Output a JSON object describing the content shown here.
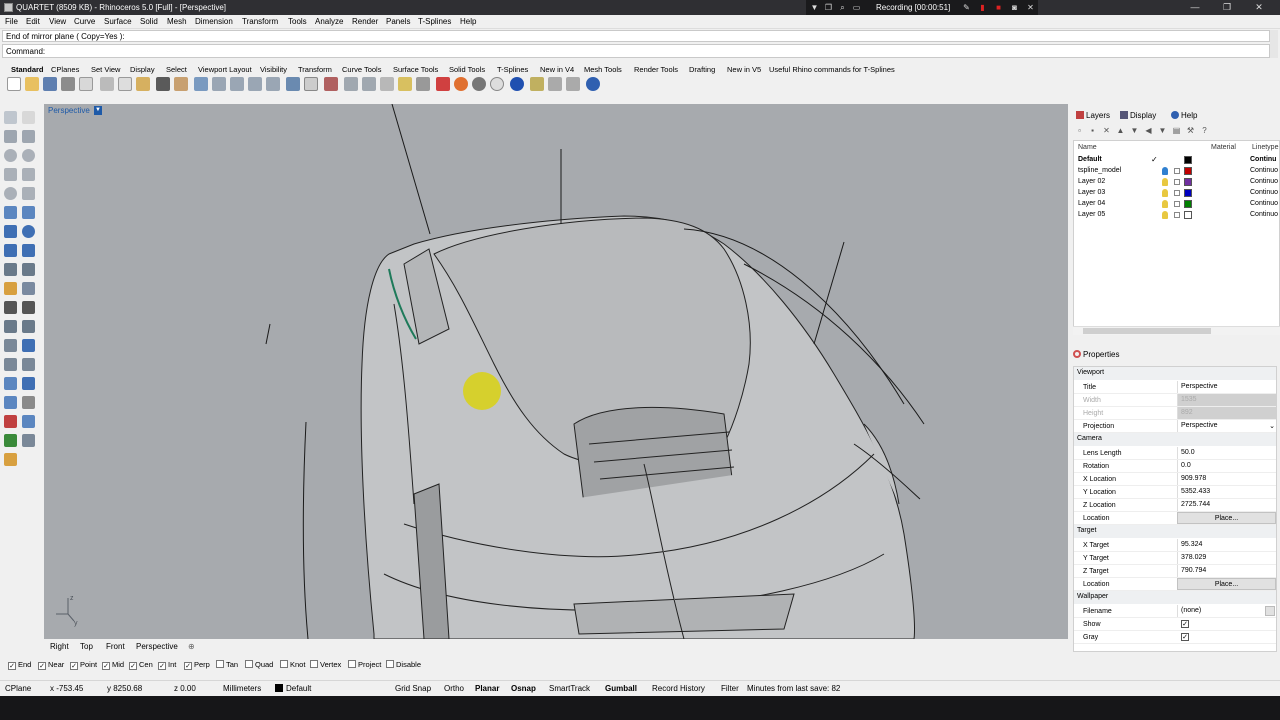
{
  "titlebar": {
    "title": "QUARTET (8509 KB) - Rhinoceros 5.0 [Full] - [Perspective]"
  },
  "recording": {
    "label": "Recording [00:00:51]"
  },
  "menu": [
    "File",
    "Edit",
    "View",
    "Curve",
    "Surface",
    "Solid",
    "Mesh",
    "Dimension",
    "Transform",
    "Tools",
    "Analyze",
    "Render",
    "Panels",
    "T-Splines",
    "Help"
  ],
  "command": {
    "history": "End of mirror plane ( Copy=Yes ):",
    "prompt": "Command:"
  },
  "toolbar_tabs": [
    "Standard",
    "CPlanes",
    "Set View",
    "Display",
    "Select",
    "Viewport Layout",
    "Visibility",
    "Transform",
    "Curve Tools",
    "Surface Tools",
    "Solid Tools",
    "T-Splines",
    "New in V4",
    "Mesh Tools",
    "Render Tools",
    "Drafting",
    "New in V5",
    "Useful Rhino commands for T-Splines"
  ],
  "viewport": {
    "title": "Perspective",
    "axis_z": "z",
    "axis_y": "y"
  },
  "viewport_tabs": [
    "Right",
    "Top",
    "Front",
    "Perspective"
  ],
  "osnap": [
    {
      "label": "End",
      "checked": true
    },
    {
      "label": "Near",
      "checked": true
    },
    {
      "label": "Point",
      "checked": true
    },
    {
      "label": "Mid",
      "checked": true
    },
    {
      "label": "Cen",
      "checked": true
    },
    {
      "label": "Int",
      "checked": true
    },
    {
      "label": "Perp",
      "checked": true
    },
    {
      "label": "Tan",
      "checked": false
    },
    {
      "label": "Quad",
      "checked": false
    },
    {
      "label": "Knot",
      "checked": false
    },
    {
      "label": "Vertex",
      "checked": false
    },
    {
      "label": "Project",
      "checked": false
    },
    {
      "label": "Disable",
      "checked": false
    }
  ],
  "status": {
    "cplane": "CPlane",
    "x": "x -753.45",
    "y": "y 8250.68",
    "z": "z 0.00",
    "units": "Millimeters",
    "layer": "Default",
    "grid_snap": "Grid Snap",
    "ortho": "Ortho",
    "planar": "Planar",
    "osnap": "Osnap",
    "smarttrack": "SmartTrack",
    "gumball": "Gumball",
    "record_history": "Record History",
    "filter": "Filter",
    "last_save": "Minutes from last save: 82"
  },
  "panel_tabs": [
    "Layers",
    "Display",
    "Help"
  ],
  "layers": {
    "headers": {
      "name": "Name",
      "material": "Material",
      "linetype": "Linetype"
    },
    "rows": [
      {
        "name": "Default",
        "current": "✓",
        "color": "#000000",
        "linetype": "Continu"
      },
      {
        "name": "tspline_model",
        "current": "",
        "color": "#c00000",
        "linetype": "Continuo"
      },
      {
        "name": "Layer 02",
        "current": "",
        "color": "#7030a0",
        "linetype": "Continuo"
      },
      {
        "name": "Layer 03",
        "current": "",
        "color": "#0000c0",
        "linetype": "Continuo"
      },
      {
        "name": "Layer 04",
        "current": "",
        "color": "#008000",
        "linetype": "Continuo"
      },
      {
        "name": "Layer 05",
        "current": "",
        "color": "#ffffff",
        "linetype": "Continuo"
      }
    ]
  },
  "properties": {
    "title": "Properties",
    "viewport_section": "Viewport",
    "title_label": "Title",
    "title_value": "Perspective",
    "width_label": "Width",
    "width_value": "1535",
    "height_label": "Height",
    "height_value": "892",
    "projection_label": "Projection",
    "projection_value": "Perspective",
    "camera_section": "Camera",
    "lens_label": "Lens Length",
    "lens_value": "50.0",
    "rotation_label": "Rotation",
    "rotation_value": "0.0",
    "xloc_label": "X Location",
    "xloc_value": "909.978",
    "yloc_label": "Y Location",
    "yloc_value": "5352.433",
    "zloc_label": "Z Location",
    "zloc_value": "2725.744",
    "location_label": "Location",
    "place_label": "Place...",
    "target_section": "Target",
    "xt_label": "X Target",
    "xt_value": "95.324",
    "yt_label": "Y Target",
    "yt_value": "378.029",
    "zt_label": "Z Target",
    "zt_value": "790.794",
    "tlocation_label": "Location",
    "tplace_label": "Place...",
    "wallpaper_section": "Wallpaper",
    "filename_label": "Filename",
    "filename_value": "(none)",
    "show_label": "Show",
    "gray_label": "Gray"
  }
}
